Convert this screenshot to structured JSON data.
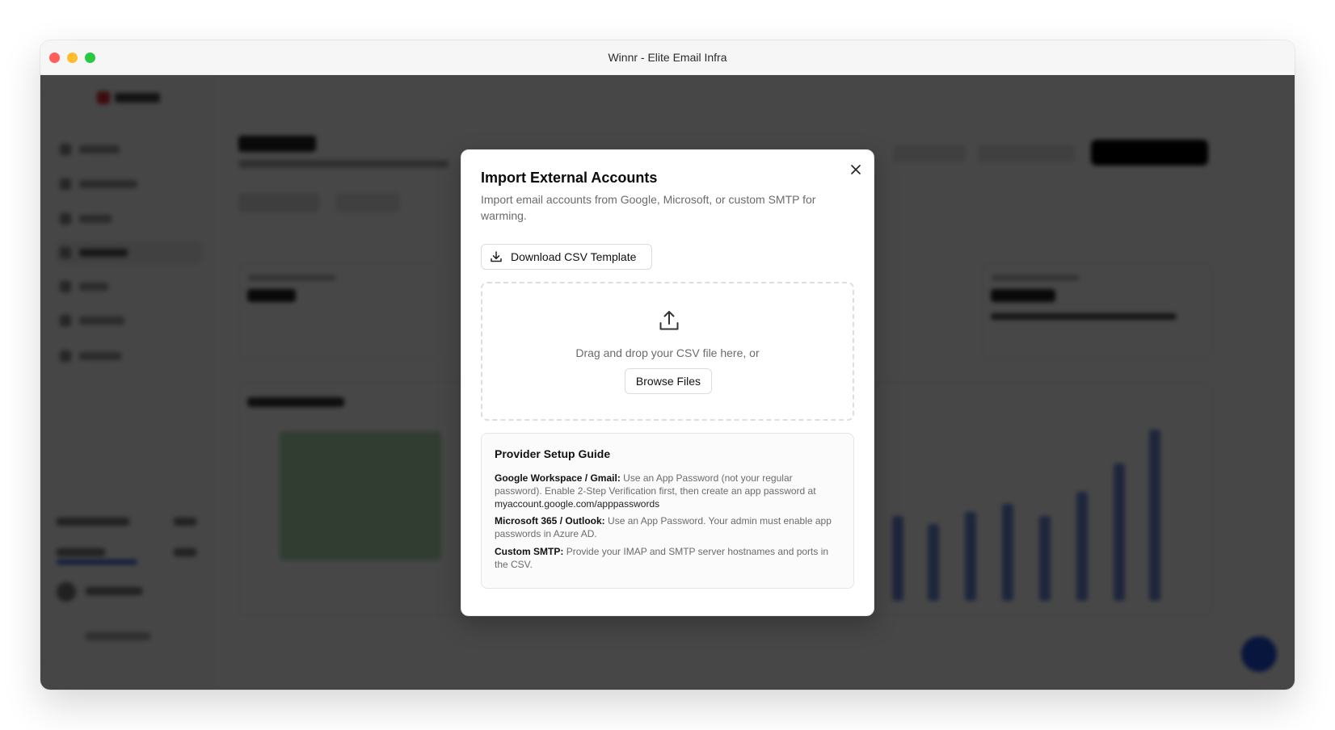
{
  "window": {
    "title": "Winnr - Elite Email Infra"
  },
  "modal": {
    "title": "Import External Accounts",
    "description": "Import email accounts from Google, Microsoft, or custom SMTP for warming.",
    "download_button": "Download CSV Template",
    "dropzone": {
      "text": "Drag and drop your CSV file here, or",
      "browse_button": "Browse Files"
    },
    "guide": {
      "title": "Provider Setup Guide",
      "items": [
        {
          "label": "Google Workspace / Gmail:",
          "text": "Use an App Password (not your regular password). Enable 2-Step Verification first, then create an app password at",
          "link": "myaccount.google.com/apppasswords"
        },
        {
          "label": "Microsoft 365 / Outlook:",
          "text": "Use an App Password. Your admin must enable app passwords in Azure AD."
        },
        {
          "label": "Custom SMTP:",
          "text": "Provide your IMAP and SMTP server hostnames and ports in the CSV."
        }
      ]
    }
  },
  "icons": {
    "close": "close-icon",
    "download": "download-icon",
    "upload": "upload-icon"
  },
  "colors": {
    "overlay": "#000000",
    "traffic_red": "#ff5f57",
    "traffic_yellow": "#febc2e",
    "traffic_green": "#28c840",
    "fab": "#1d4ed8"
  }
}
